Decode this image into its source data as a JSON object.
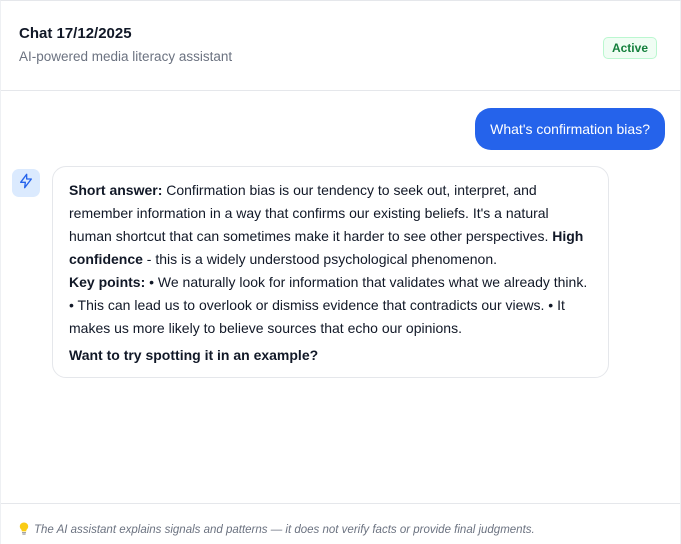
{
  "header": {
    "title": "Chat 17/12/2025",
    "subtitle": "AI-powered media literacy assistant",
    "status": "Active"
  },
  "conversation": {
    "user_message": "What's confirmation bias?",
    "assistant": {
      "avatar_icon": "lightning-bolt-icon",
      "short_answer_label": "Short answer:",
      "short_answer_text": " Confirmation bias is our tendency to seek out, interpret, and remember information in a way that confirms our existing beliefs. It's a natural human shortcut that can sometimes make it harder to see other perspectives. ",
      "confidence_label": "High confidence",
      "confidence_text": " - this is a widely understood psychological phenomenon.",
      "key_points_label": "Key points:",
      "key_points_text": " • We naturally look for information that validates what we already think. • This can lead us to overlook or dismiss evidence that contradicts our views. • It makes us more likely to believe sources that echo our opinions.",
      "follow_up": "Want to try spotting it in an example?"
    }
  },
  "footer": {
    "icon": "lightbulb-icon",
    "note": "The AI assistant explains signals and patterns — it does not verify facts or provide final judgments."
  },
  "colors": {
    "accent": "#2563eb",
    "status_green": "#15803d",
    "avatar_bg": "#dbeafe"
  }
}
